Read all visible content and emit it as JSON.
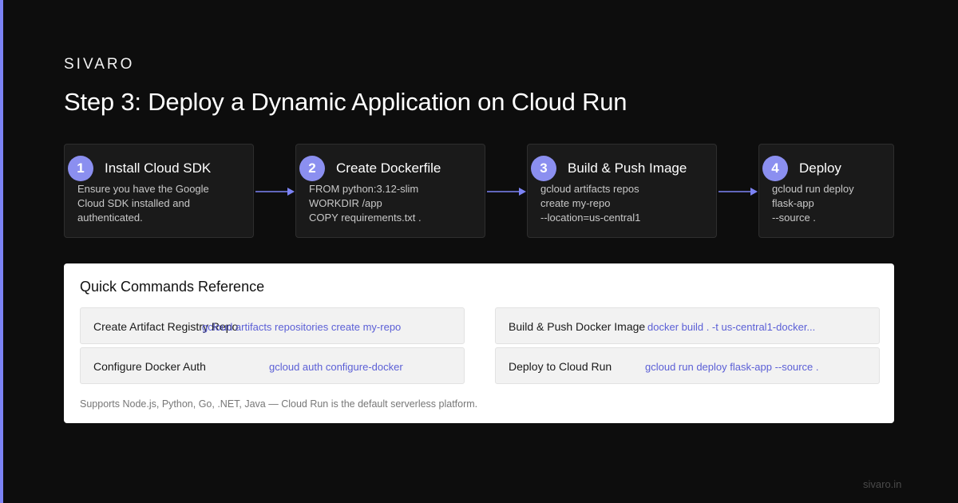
{
  "brand": "SIVARO",
  "title": "Step 3: Deploy a Dynamic Application on Cloud Run",
  "steps": [
    {
      "num": "1",
      "title": "Install Cloud SDK",
      "desc": "Ensure you have the Google\nCloud SDK installed and\nauthenticated."
    },
    {
      "num": "2",
      "title": "Create Dockerfile",
      "desc": "FROM python:3.12-slim\nWORKDIR /app\nCOPY requirements.txt ."
    },
    {
      "num": "3",
      "title": "Build & Push Image",
      "desc": "gcloud artifacts repos\ncreate my-repo\n--location=us-central1"
    },
    {
      "num": "4",
      "title": "Deploy",
      "desc": "gcloud run deploy\nflask-app\n--source ."
    }
  ],
  "reference": {
    "title": "Quick Commands Reference",
    "commands": [
      {
        "label": "Create Artifact Registry Repo",
        "code": "gcloud artifacts repositories create my-repo"
      },
      {
        "label": "Build & Push Docker Image",
        "code": "docker build . -t us-central1-docker..."
      },
      {
        "label": "Configure Docker Auth",
        "code": "gcloud auth configure-docker"
      },
      {
        "label": "Deploy to Cloud Run",
        "code": "gcloud run deploy flask-app --source ."
      }
    ],
    "note": "Supports Node.js, Python, Go, .NET, Java — Cloud Run is the default serverless platform."
  },
  "footer": "sivaro.in",
  "colors": {
    "accent": "#7c83f5",
    "badge": "#8b8ff0",
    "code": "#5b5fd6",
    "background": "#0d0d0d"
  }
}
